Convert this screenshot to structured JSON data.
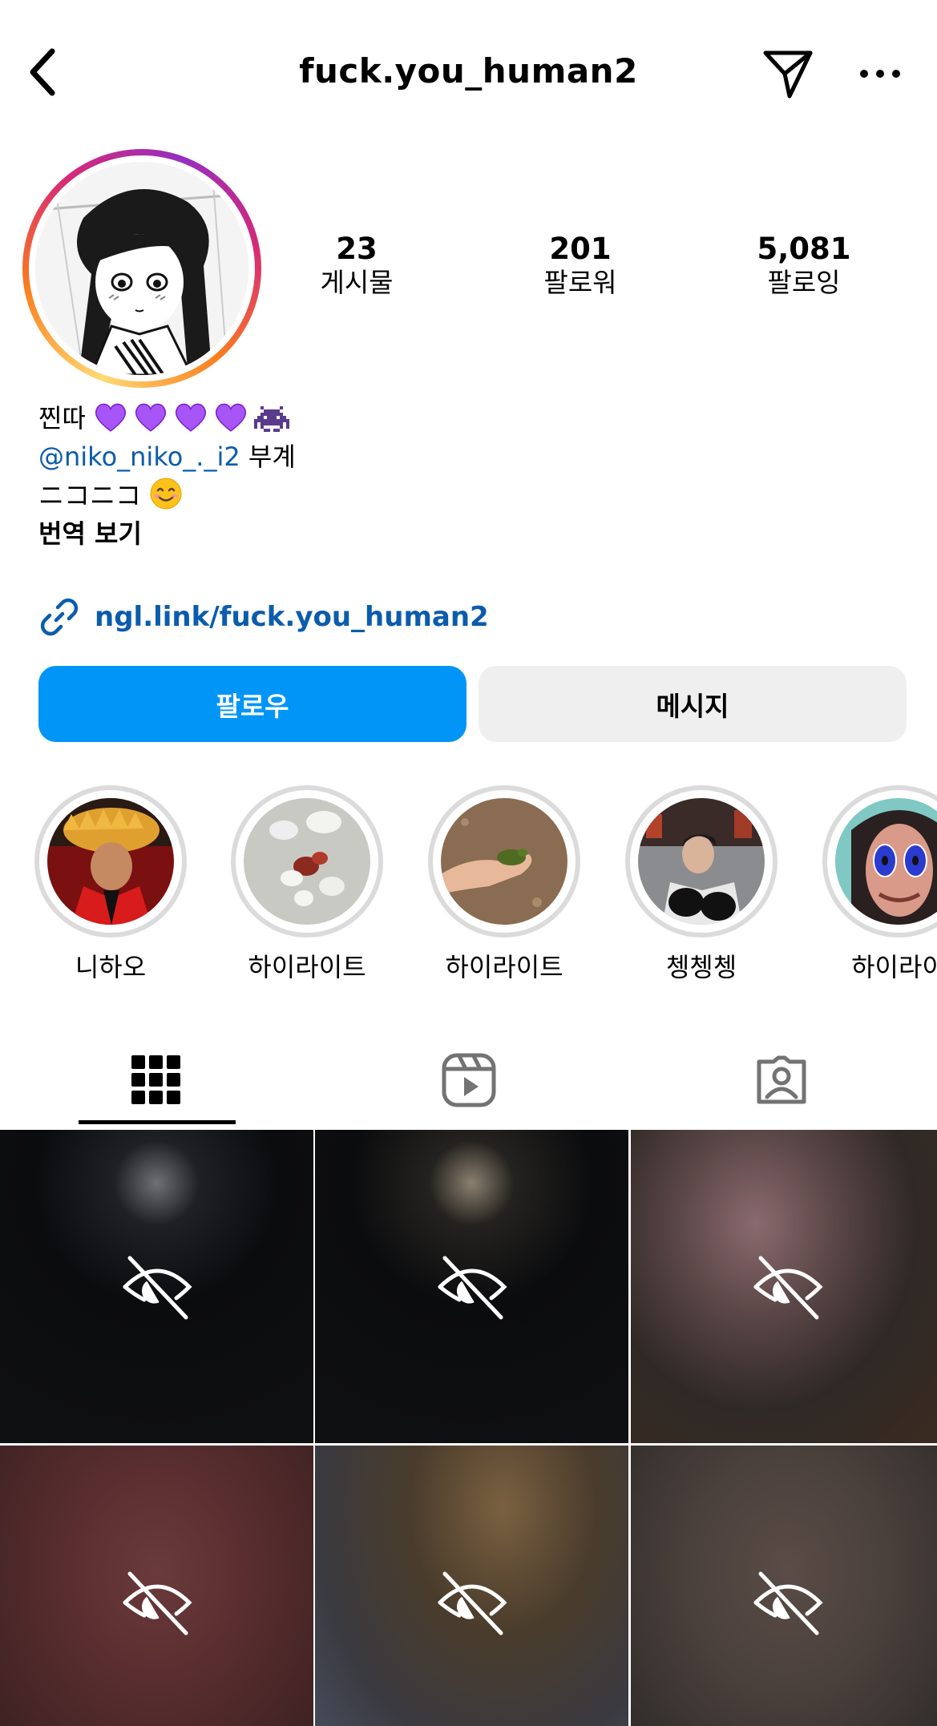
{
  "header": {
    "username": "fuck.you_human2"
  },
  "stats": [
    {
      "value": "23",
      "label": "게시물"
    },
    {
      "value": "201",
      "label": "팔로워"
    },
    {
      "value": "5,081",
      "label": "팔로잉"
    }
  ],
  "bio": {
    "line1_text": "찐따",
    "mention": "@niko_niko_._i2",
    "mention_suffix": " 부계",
    "line3_text": "ニコニコ",
    "translate": "번역 보기"
  },
  "link": {
    "text": "ngl.link/fuck.you_human2"
  },
  "buttons": {
    "follow": "팔로우",
    "message": "메시지"
  },
  "highlights": [
    {
      "label": "니하오"
    },
    {
      "label": "하이라이트"
    },
    {
      "label": "하이라이트"
    },
    {
      "label": "쳉쳉쳉"
    },
    {
      "label": "하이라이"
    }
  ],
  "colors": {
    "accent": "#0095f6",
    "link": "#0b5cad",
    "heart": "#a855f7"
  }
}
